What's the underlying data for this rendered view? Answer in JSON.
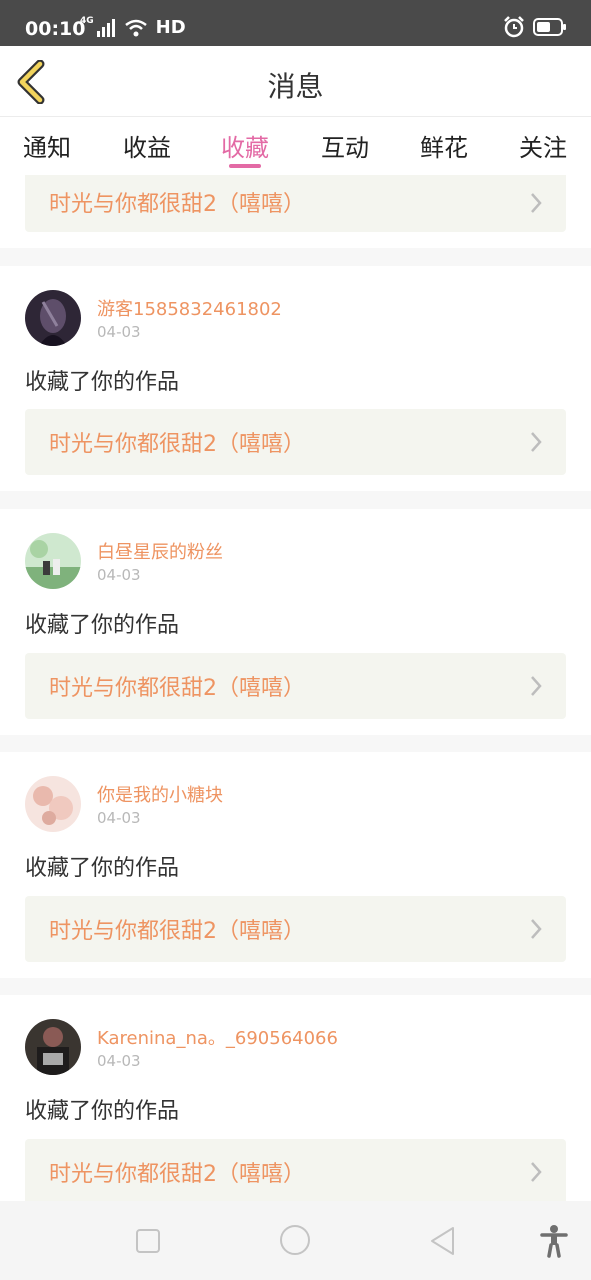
{
  "status_bar": {
    "time": "00:10",
    "network": "4G",
    "quality": "HD"
  },
  "header": {
    "title": "消息"
  },
  "tabs": [
    {
      "label": "通知"
    },
    {
      "label": "收益"
    },
    {
      "label": "收藏",
      "active": true
    },
    {
      "label": "互动"
    },
    {
      "label": "鲜花"
    },
    {
      "label": "关注"
    }
  ],
  "messages": [
    {
      "work_title": "时光与你都很甜2（嘻嘻）"
    },
    {
      "user": "游客1585832461802",
      "date": "04-03",
      "action": "收藏了你的作品",
      "work_title": "时光与你都很甜2（嘻嘻）"
    },
    {
      "user": "白昼星辰的粉丝",
      "date": "04-03",
      "action": "收藏了你的作品",
      "work_title": "时光与你都很甜2（嘻嘻）"
    },
    {
      "user": "你是我的小糖块",
      "date": "04-03",
      "action": "收藏了你的作品",
      "work_title": "时光与你都很甜2（嘻嘻）"
    },
    {
      "user": "Karenina_na。_690564066",
      "date": "04-03",
      "action": "收藏了你的作品",
      "work_title": "时光与你都很甜2（嘻嘻）"
    }
  ],
  "icons": {
    "back": "chevron-left-icon",
    "item_arrow": "chevron-right-icon",
    "nav": [
      "square-icon",
      "circle-icon",
      "triangle-back-icon",
      "accessibility-icon"
    ]
  },
  "colors": {
    "accent_pink": "#e36aa5",
    "accent_orange": "#ee9462",
    "back_yellow": "#f2d45c"
  }
}
